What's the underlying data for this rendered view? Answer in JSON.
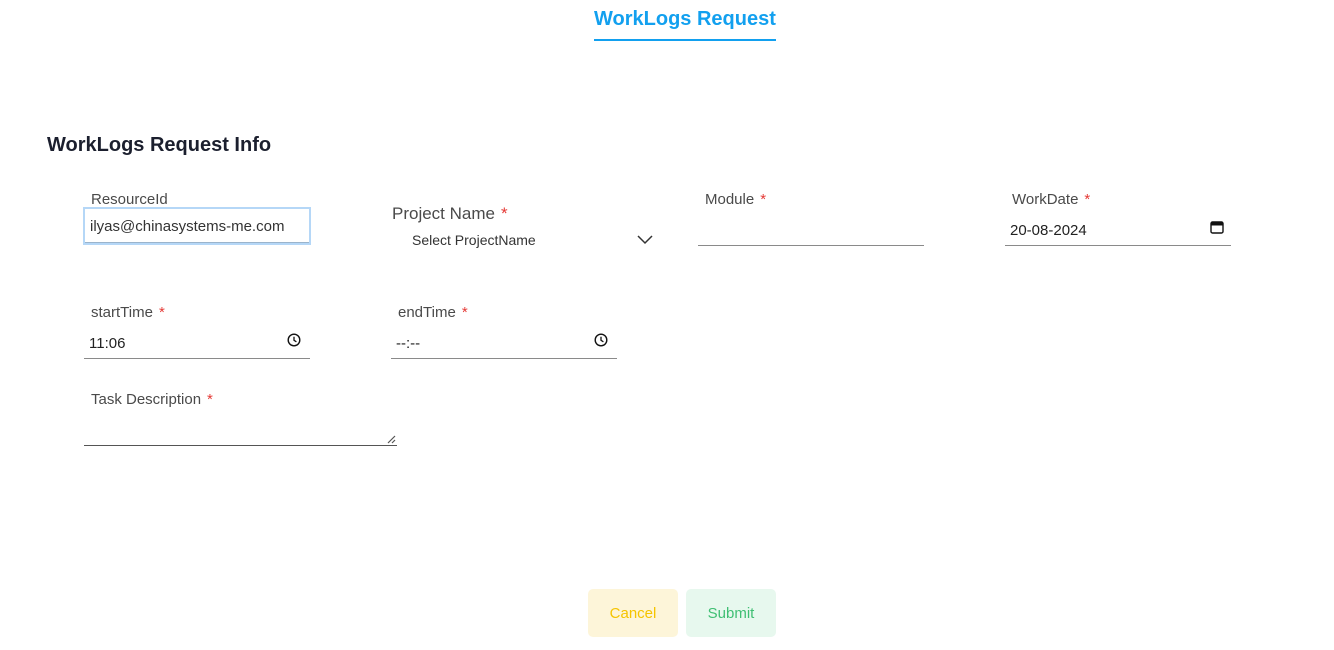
{
  "header": {
    "tab_label": "WorkLogs Request"
  },
  "section": {
    "title": "WorkLogs Request Info"
  },
  "fields": {
    "resource_id": {
      "label": "ResourceId",
      "value": "ilyas@chinasystems-me.com"
    },
    "project_name": {
      "label": "Project Name",
      "required_mark": "*",
      "placeholder": "Select ProjectName"
    },
    "module": {
      "label": "Module",
      "required_mark": "*",
      "value": ""
    },
    "work_date": {
      "label": "WorkDate",
      "required_mark": "*",
      "value": "20-08-2024"
    },
    "start_time": {
      "label": "startTime",
      "required_mark": "*",
      "value": "11:06"
    },
    "end_time": {
      "label": "endTime",
      "required_mark": "*",
      "value": "--:--"
    },
    "task_description": {
      "label": "Task Description",
      "required_mark": "*",
      "value": ""
    }
  },
  "actions": {
    "cancel_label": "Cancel",
    "submit_label": "Submit"
  },
  "colors": {
    "accent": "#12a0ef",
    "required": "#e53935",
    "cancel_bg": "#fdf5d9",
    "cancel_text": "#f5c400",
    "submit_bg": "#e7f8ee",
    "submit_text": "#3fbf73"
  },
  "icons": {
    "dropdown": "chevron-down-icon",
    "date": "calendar-icon",
    "time": "clock-icon",
    "resize": "resize-grip-icon"
  }
}
